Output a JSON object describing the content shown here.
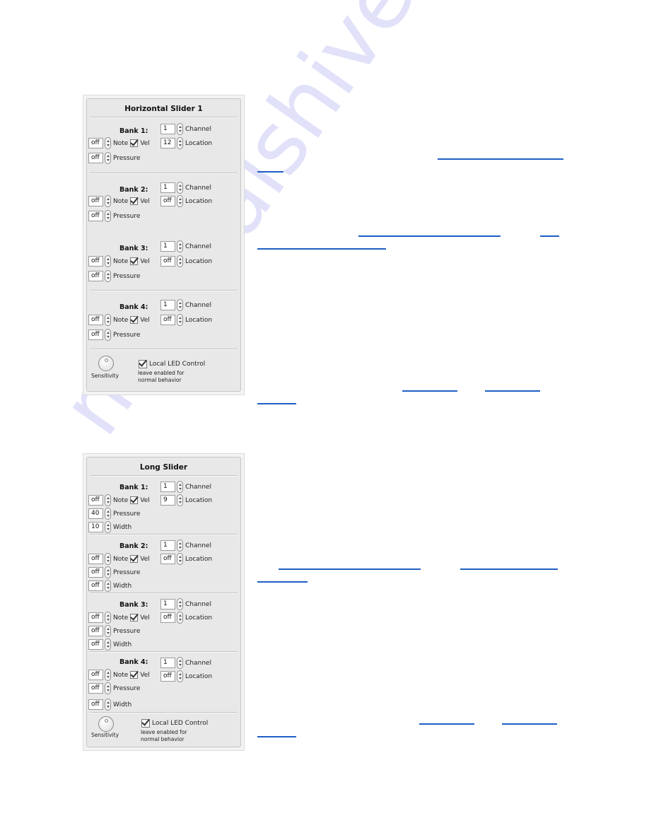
{
  "watermark": "manualshive.com",
  "panels": [
    {
      "title": "Horizontal Slider 1",
      "banks": [
        {
          "label": "Bank 1:",
          "channel": "1",
          "note": "off",
          "location": "12",
          "pressure": "off",
          "vel_checked": true
        },
        {
          "label": "Bank 2:",
          "channel": "1",
          "note": "off",
          "location": "off",
          "pressure": "off",
          "vel_checked": true
        },
        {
          "label": "Bank 3:",
          "channel": "1",
          "note": "off",
          "location": "off",
          "pressure": "off",
          "vel_checked": true
        },
        {
          "label": "Bank 4:",
          "channel": "1",
          "note": "off",
          "location": "off",
          "pressure": "off",
          "vel_checked": true
        }
      ],
      "footer": {
        "knob_label": "Sensitivity",
        "checkbox_label": "Local LED Control",
        "hint_line1": "leave enabled for",
        "hint_line2": "normal behavior"
      }
    },
    {
      "title": "Long Slider",
      "banks": [
        {
          "label": "Bank 1:",
          "channel": "1",
          "note": "off",
          "location": "9",
          "pressure": "40",
          "width": "10",
          "vel_checked": true
        },
        {
          "label": "Bank 2:",
          "channel": "1",
          "note": "off",
          "location": "off",
          "pressure": "off",
          "width": "off",
          "vel_checked": true
        },
        {
          "label": "Bank 3:",
          "channel": "1",
          "note": "off",
          "location": "off",
          "pressure": "off",
          "width": "off",
          "vel_checked": true
        },
        {
          "label": "Bank 4:",
          "channel": "1",
          "note": "off",
          "location": "off",
          "pressure": "off",
          "width": "off",
          "vel_checked": true
        }
      ],
      "footer": {
        "knob_label": "Sensitivity",
        "checkbox_label": "Local LED Control",
        "hint_line1": "leave enabled for",
        "hint_line2": "normal behavior"
      }
    }
  ],
  "labels": {
    "channel": "Channel",
    "location": "Location",
    "note": "Note",
    "vel": "Vel",
    "pressure": "Pressure",
    "width": "Width"
  },
  "link_color": "#1f5fc4"
}
